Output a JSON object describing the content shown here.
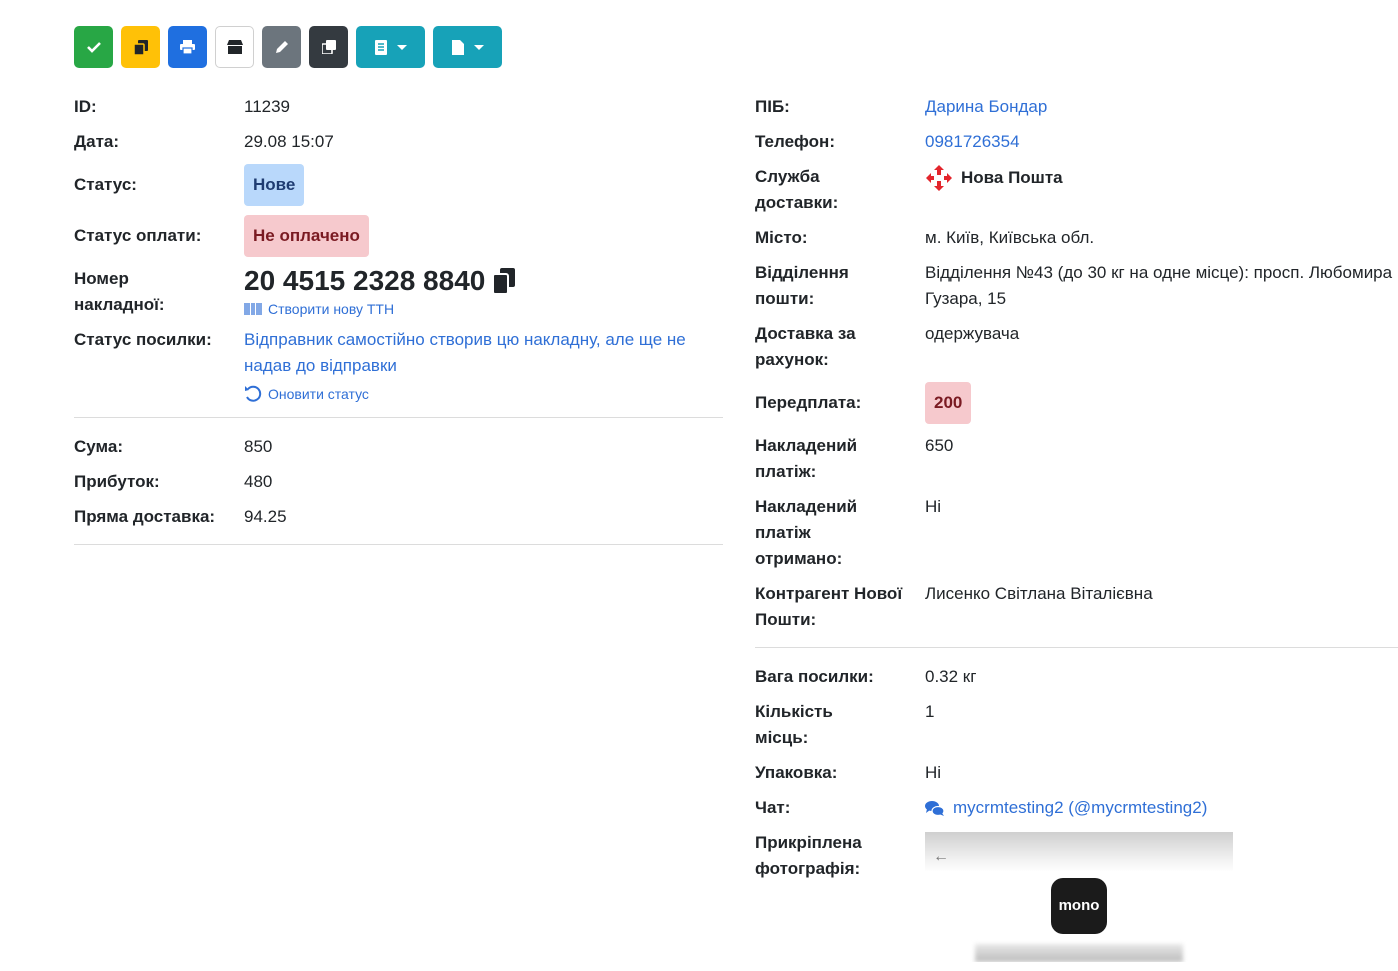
{
  "toolbar": {
    "buttons": [
      {
        "name": "confirm",
        "icon": "check-icon",
        "color": "#28a745"
      },
      {
        "name": "copy",
        "icon": "copy-icon",
        "color": "#ffc107"
      },
      {
        "name": "print",
        "icon": "print-icon",
        "color": "#1f6fe0"
      },
      {
        "name": "box",
        "icon": "box-icon",
        "color": "#ffffff"
      },
      {
        "name": "edit",
        "icon": "pencil-icon",
        "color": "#6c757d"
      },
      {
        "name": "duplicate",
        "icon": "clone-icon",
        "color": "#343a40"
      },
      {
        "name": "receipt-menu",
        "icon": "receipt-icon",
        "color": "#17a2b8"
      },
      {
        "name": "document-menu",
        "icon": "document-icon",
        "color": "#17a2b8"
      }
    ]
  },
  "left": {
    "id_label": "ID:",
    "id": "11239",
    "date_label": "Дата:",
    "date": "29.08 15:07",
    "status_label": "Статус:",
    "status": "Нове",
    "payment_status_label": "Статус оплати:",
    "payment_status": "Не оплачено",
    "waybill_label": "Номер накладної:",
    "waybill": "20 4515 2328 8840",
    "create_ttn": "Створити нову ТТН",
    "parcel_status_label": "Статус посилки:",
    "parcel_status": "Відправник самостійно створив цю накладну, але ще не надав до відправки",
    "refresh_status": "Оновити статус",
    "sum_label": "Сума:",
    "sum": "850",
    "profit_label": "Прибуток:",
    "profit": "480",
    "direct_delivery_label": "Пряма доставка:",
    "direct_delivery": "94.25"
  },
  "right": {
    "name_label": "ПІБ:",
    "name": "Дарина Бондар",
    "phone_label": "Телефон:",
    "phone": "0981726354",
    "delivery_service_label": "Служба доставки:",
    "delivery_service": "Нова Пошта",
    "city_label": "Місто:",
    "city": "м. Київ, Київська обл.",
    "branch_label": "Відділення пошти:",
    "branch": "Відділення №43 (до 30 кг на одне місце): просп. Любомира Гузара, 15",
    "payer_label": "Доставка за рахунок:",
    "payer": "одержувача",
    "prepayment_label": "Передплата:",
    "prepayment": "200",
    "cod_label": "Накладений платіж:",
    "cod": "650",
    "cod_received_label": "Накладений платіж отримано:",
    "cod_received": "Ні",
    "counterparty_label": "Контрагент Нової Пошти:",
    "counterparty": "Лисенко Світлана Віталієвна",
    "weight_label": "Вага посилки:",
    "weight": "0.32 кг",
    "places_label": "Кількість місць:",
    "places": "1",
    "packaging_label": "Упаковка:",
    "packaging": "Ні",
    "chat_label": "Чат:",
    "chat": "mycrmtesting2 (@mycrmtesting2)",
    "photo_label": "Прикріплена фотографія:",
    "photo_logo_text": "mono"
  }
}
